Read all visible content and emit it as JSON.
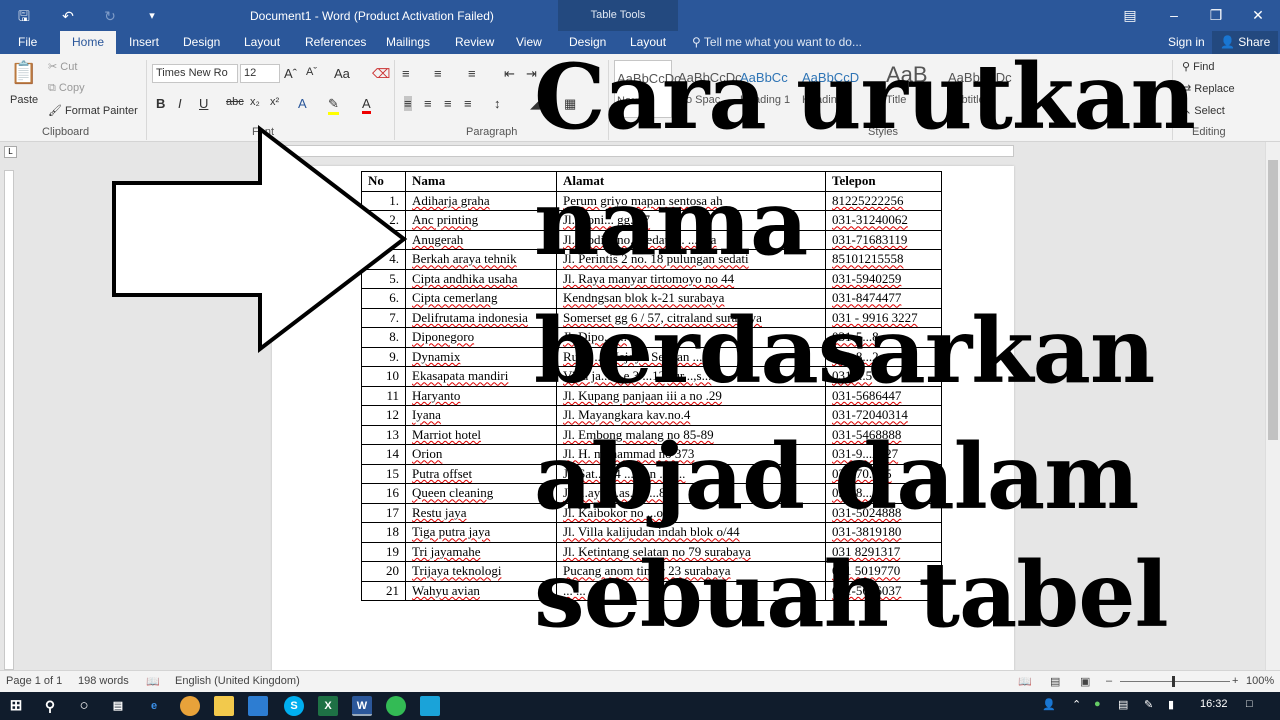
{
  "titlebar": {
    "title": "Document1 - Word (Product Activation Failed)",
    "context_tab": "Table Tools"
  },
  "tabs": [
    "File",
    "Home",
    "Insert",
    "Design",
    "Layout",
    "References",
    "Mailings",
    "Review",
    "View",
    "Design",
    "Layout"
  ],
  "tell_me": "Tell me what you want to do...",
  "sign_in": "Sign in",
  "share": "Share",
  "clipboard": {
    "paste": "Paste",
    "cut": "Cut",
    "copy": "Copy",
    "format_painter": "Format Painter",
    "label": "Clipboard"
  },
  "font": {
    "name": "Times New Ro",
    "size": "12",
    "label": "Font"
  },
  "paragraph": {
    "label": "Paragraph"
  },
  "styles": {
    "label": "Styles",
    "items": [
      "AaBbCcDc",
      "AaBbCcDc",
      "AaBbCc",
      "AaBbCcD",
      "AaB",
      "AaBbCcDc"
    ],
    "names": [
      "Normal",
      "No Spac...",
      "Heading 1",
      "Heading 2",
      "Title",
      "Subtitle"
    ]
  },
  "editing": {
    "find": "Find",
    "replace": "Replace",
    "select": "Select",
    "label": "Editing"
  },
  "table": {
    "headers": [
      "No",
      "Nama",
      "Alamat",
      "Telepon"
    ],
    "rows": [
      [
        "1.",
        "Adiharja graha",
        "Perum griyo mapan sentosa ah",
        "81225222256"
      ],
      [
        "2.",
        "Anc printing",
        "Jl. Doni... gg.v/7",
        "031-31240062"
      ],
      [
        "3.",
        "Anugerah",
        "Jl. Kodi... no. ...edati ... ...uda",
        "031-71683119"
      ],
      [
        "4.",
        "Berkah araya tehnik",
        "Jl. Perintis 2 no. 18 pulungan sedati",
        "85101215558"
      ],
      [
        "5.",
        "Cipta andhika usaha",
        "Jl. Raya manyar tirtomoyo no 44",
        "031-5940259"
      ],
      [
        "6.",
        "Cipta cemerlang",
        "Kendngsan blok k-21 surabaya",
        "031-8474477"
      ],
      [
        "7.",
        "Delifrutama indonesia",
        "Somerset gg 6 / 57, citraland surabaya",
        "031 - 9916 3227"
      ],
      [
        "8.",
        "Diponegoro",
        "Jl. Dipo... ...",
        "031-5...8"
      ],
      [
        "9.",
        "Dynamix",
        "Ruko ... Mejoyo Selatan ...",
        "031-8...2"
      ],
      [
        "10",
        "Ekasapata mandiri",
        "Villa ja... ...e 3 ...12,sur...,s...",
        "031-...5"
      ],
      [
        "11",
        "Haryanto",
        "Jl. Kupang panjaan iii a no .29",
        "031-5686447"
      ],
      [
        "12",
        "Iyana",
        "Jl. Mayangkara kav.no.4",
        "031-72040314"
      ],
      [
        "13",
        "Marriot hotel",
        "Jl. Embong malang no 85-89",
        "031-5468888"
      ],
      [
        "14",
        "Orion",
        "Jl. H. muhammad no 373",
        "031-9...2227"
      ],
      [
        "15",
        "Putra offset",
        "Jl. Sat... 24 ...man ...d...",
        "031-70...55"
      ],
      [
        "16",
        "Queen cleaning",
        "Jl. ...aya ...as...o ...8",
        "031-8...5"
      ],
      [
        "17",
        "Restu jaya",
        "Jl. Kaibokor no ...o",
        "031-5024888"
      ],
      [
        "18",
        "Tiga putra jaya",
        "Jl. Villa kalijudan indah blok o/44",
        "031-3819180"
      ],
      [
        "19",
        "Tri jayamahe",
        "Jl. Ketintang selatan no 79 surabaya",
        "031 8291317"
      ],
      [
        "20",
        "Trijaya teknologi",
        "Pucang anom timur 23 surabaya",
        "031 5019770"
      ],
      [
        "21",
        "Wahyu avian",
        "... ...",
        "031-5676037"
      ]
    ]
  },
  "overlay": {
    "lines": [
      "Cara urutkan",
      "nama",
      "berdasarkan",
      "abjad dalam",
      "sebuah tabel"
    ]
  },
  "status": {
    "page": "Page 1 of 1",
    "words": "198 words",
    "lang": "English (United Kingdom)",
    "zoom": "100%"
  },
  "taskbar": {
    "time": "16:32"
  }
}
